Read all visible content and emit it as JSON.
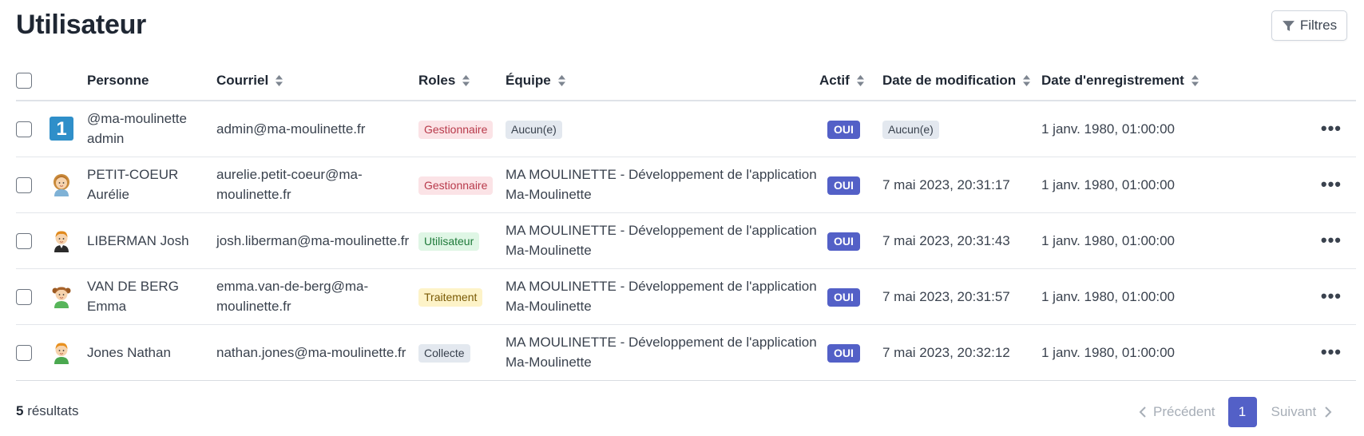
{
  "page": {
    "title": "Utilisateur"
  },
  "toolbar": {
    "filters_label": "Filtres",
    "filters_icon": "filter-icon"
  },
  "table": {
    "columns": {
      "person": "Personne",
      "email": "Courriel",
      "roles": "Roles",
      "team": "Équipe",
      "active": "Actif",
      "modified": "Date de modification",
      "registered": "Date d'enregistrement"
    },
    "rows": [
      {
        "avatar": "number-one-avatar",
        "avatar_text": "1",
        "name_line1": "@ma-moulinette",
        "name_line2": "admin",
        "email_line1": "admin@ma-moulinette.fr",
        "email_line2": "",
        "role": "Gestionnaire",
        "role_kind": "gest",
        "team_line1": "Aucun(e)",
        "team_line2": "",
        "team_is_badge": true,
        "active": "OUI",
        "modified": "Aucun(e)",
        "modified_is_badge": true,
        "registered": "1 janv. 1980, 01:00:00"
      },
      {
        "avatar": "woman-avatar-icon",
        "avatar_text": "",
        "name_line1": "PETIT-COEUR",
        "name_line2": "Aurélie",
        "email_line1": "aurelie.petit-coeur@ma-",
        "email_line2": "moulinette.fr",
        "role": "Gestionnaire",
        "role_kind": "gest",
        "team_line1": "MA MOULINETTE - Développement de l'application",
        "team_line2": "Ma-Moulinette",
        "team_is_badge": false,
        "active": "OUI",
        "modified": "7 mai 2023, 20:31:17",
        "modified_is_badge": false,
        "registered": "1 janv. 1980, 01:00:00"
      },
      {
        "avatar": "man-avatar-icon",
        "avatar_text": "",
        "name_line1": "LIBERMAN Josh",
        "name_line2": "",
        "email_line1": "josh.liberman@ma-moulinette.fr",
        "email_line2": "",
        "role": "Utilisateur",
        "role_kind": "util",
        "team_line1": "MA MOULINETTE - Développement de l'application",
        "team_line2": "Ma-Moulinette",
        "team_is_badge": false,
        "active": "OUI",
        "modified": "7 mai 2023, 20:31:43",
        "modified_is_badge": false,
        "registered": "1 janv. 1980, 01:00:00"
      },
      {
        "avatar": "girl-avatar-icon",
        "avatar_text": "",
        "name_line1": "VAN DE BERG",
        "name_line2": "Emma",
        "email_line1": "emma.van-de-berg@ma-",
        "email_line2": "moulinette.fr",
        "role": "Traitement",
        "role_kind": "trait",
        "team_line1": "MA MOULINETTE - Développement de l'application",
        "team_line2": "Ma-Moulinette",
        "team_is_badge": false,
        "active": "OUI",
        "modified": "7 mai 2023, 20:31:57",
        "modified_is_badge": false,
        "registered": "1 janv. 1980, 01:00:00"
      },
      {
        "avatar": "boy-avatar-icon",
        "avatar_text": "",
        "name_line1": "Jones Nathan",
        "name_line2": "",
        "email_line1": "nathan.jones@ma-moulinette.fr",
        "email_line2": "",
        "role": "Collecte",
        "role_kind": "coll",
        "team_line1": "MA MOULINETTE - Développement de l'application",
        "team_line2": "Ma-Moulinette",
        "team_is_badge": false,
        "active": "OUI",
        "modified": "7 mai 2023, 20:32:12",
        "modified_is_badge": false,
        "registered": "1 janv. 1980, 01:00:00"
      }
    ],
    "row_menu_label": "•••"
  },
  "footer": {
    "count": "5",
    "count_suffix": " résultats",
    "prev_label": "Précédent",
    "page": "1",
    "next_label": "Suivant"
  },
  "colors": {
    "accent": "#5360c7",
    "link": "#5b66c4"
  }
}
